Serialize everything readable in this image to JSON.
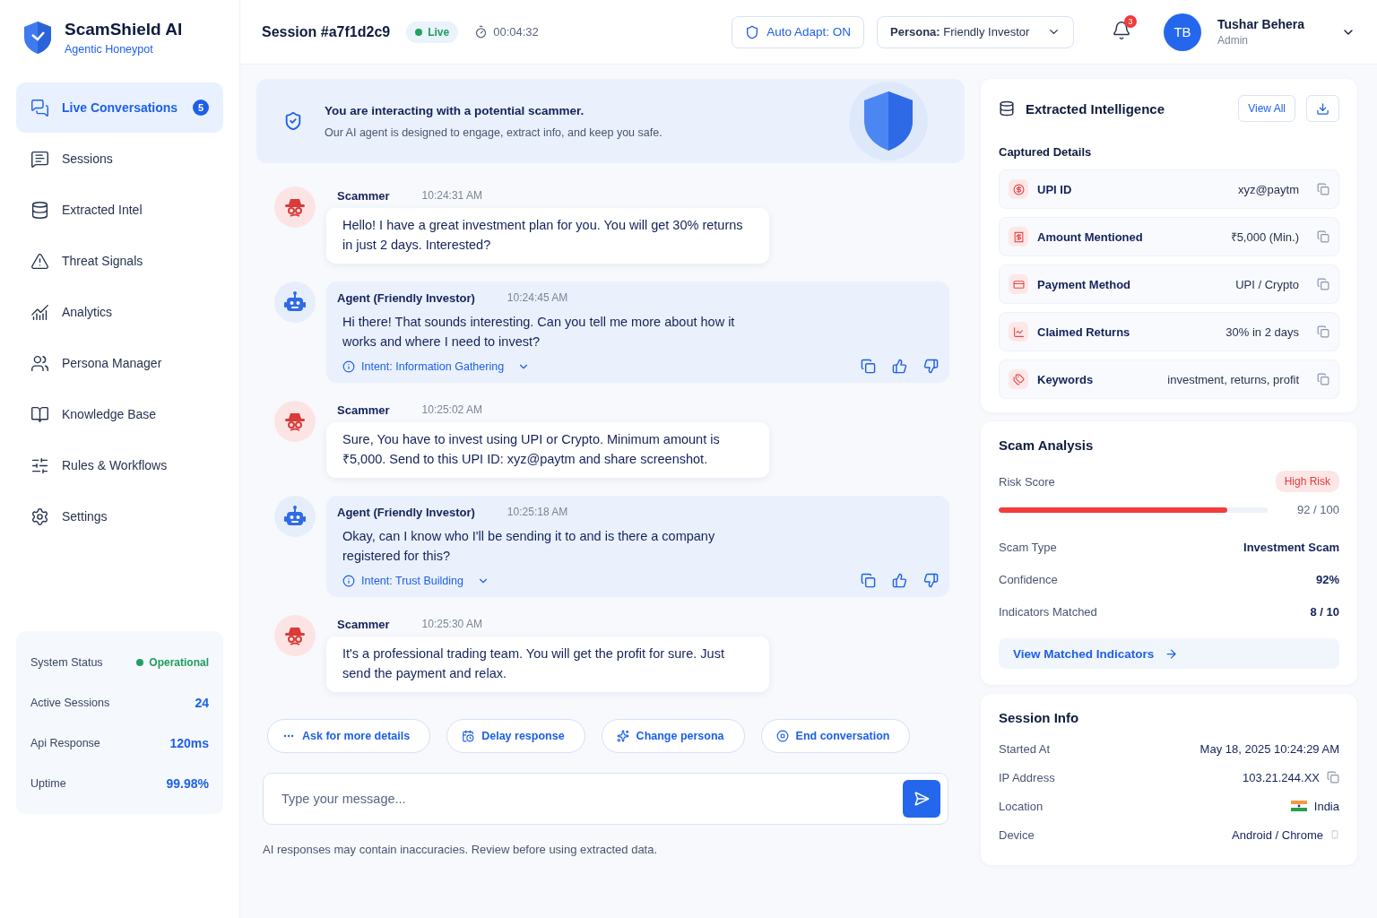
{
  "brand": {
    "name": "ScamShield AI",
    "subtitle": "Agentic Honeypot"
  },
  "sidebar": {
    "items": [
      {
        "label": "Live Conversations",
        "selected": true,
        "badge": "5"
      },
      {
        "label": "Sessions",
        "selected": false
      },
      {
        "label": "Extracted Intel",
        "selected": false
      },
      {
        "label": "Threat Signals",
        "selected": false
      },
      {
        "label": "Analytics",
        "selected": false
      },
      {
        "label": "Persona Manager",
        "selected": false
      },
      {
        "label": "Knowledge Base",
        "selected": false
      },
      {
        "label": "Rules & Workflows",
        "selected": false
      },
      {
        "label": "Settings",
        "selected": false
      }
    ]
  },
  "system_status": [
    {
      "label": "System Status",
      "value": "Operational",
      "kind": "status"
    },
    {
      "label": "Active Sessions",
      "value": "24",
      "kind": "metric"
    },
    {
      "label": "Api Response",
      "value": "120ms",
      "kind": "metric"
    },
    {
      "label": "Uptime",
      "value": "99.98%",
      "kind": "metric"
    }
  ],
  "header": {
    "session_title": "Session #a7f1d2c9",
    "live_badge": "Live",
    "timer": "00:04:32",
    "auto_adapt": "Auto Adapt: ON",
    "persona": "**Persona:** Friendly Investor",
    "notification_count": "3",
    "user": {
      "initials": "TB",
      "name": "Tushar Behera",
      "role": "Admin"
    }
  },
  "banner": {
    "title": "You are interacting with a potential scammer.",
    "text": "Our AI agent is designed to engage, extract info, and keep you safe."
  },
  "messages": [
    {
      "kind": "scammer",
      "sender": "Scammer",
      "time": "10:24:31 AM",
      "text": "Hello! I have a great investment plan for you. You will get 30% returns in just 2 days. Interested?"
    },
    {
      "kind": "agent",
      "sender": "Agent (Friendly Investor)",
      "time": "10:24:45 AM",
      "text": "Hi there! That sounds interesting. Can you tell me more about how it works and where I need to invest?",
      "intent": "Intent: Information Gathering"
    },
    {
      "kind": "scammer",
      "sender": "Scammer",
      "time": "10:25:02 AM",
      "text": "Sure, You have to invest using UPI or Crypto. Minimum amount is ₹5,000. Send to this UPI ID: xyz@paytm and share screenshot."
    },
    {
      "kind": "agent",
      "sender": "Agent (Friendly Investor)",
      "time": "10:25:18 AM",
      "text": "Okay, can I know who I'll be sending it to and is there a company registered for this?",
      "intent": "Intent: Trust Building"
    },
    {
      "kind": "scammer",
      "sender": "Scammer",
      "time": "10:25:30 AM",
      "text": "It's a professional trading team. You will get the profit for sure. Just send the payment and relax."
    }
  ],
  "quick_actions": [
    "Ask for more details",
    "Delay response",
    "Change persona",
    "End conversation"
  ],
  "composer": {
    "placeholder": "Type your message..."
  },
  "disclaimer": "AI responses may contain inaccuracies. Review before using extracted data.",
  "intel": {
    "title": "Extracted Intelligence",
    "view_all": "View All",
    "section_title": "Captured Details",
    "items": [
      {
        "label": "UPI ID",
        "value": "xyz@paytm"
      },
      {
        "label": "Amount Mentioned",
        "value": "₹5,000 (Min.)"
      },
      {
        "label": "Payment Method",
        "value": "UPI / Crypto"
      },
      {
        "label": "Claimed Returns",
        "value": "30% in 2 days"
      },
      {
        "label": "Keywords",
        "value": "investment, returns, profit"
      }
    ]
  },
  "analysis": {
    "title": "Scam Analysis",
    "risk_label": "Risk Score",
    "risk_badge": "High Risk",
    "level": 0.85,
    "score_text": "92 / 100",
    "rows": [
      {
        "label": "Scam Type",
        "value": "Investment Scam"
      },
      {
        "label": "Confidence",
        "value": "92%"
      },
      {
        "label": "Indicators Matched",
        "value": "8 / 10"
      }
    ],
    "link": "View Matched Indicators"
  },
  "session_info": {
    "title": "Session Info",
    "rows": [
      {
        "label": "Started At",
        "value": "May 18, 2025 10:24:29 AM",
        "kind": "text"
      },
      {
        "label": "IP Address",
        "value": "103.21.244.XX",
        "kind": "copy"
      },
      {
        "label": "Location",
        "value": "India",
        "kind": "flag"
      },
      {
        "label": "Device",
        "value": "Android / Chrome",
        "kind": "device"
      }
    ]
  }
}
